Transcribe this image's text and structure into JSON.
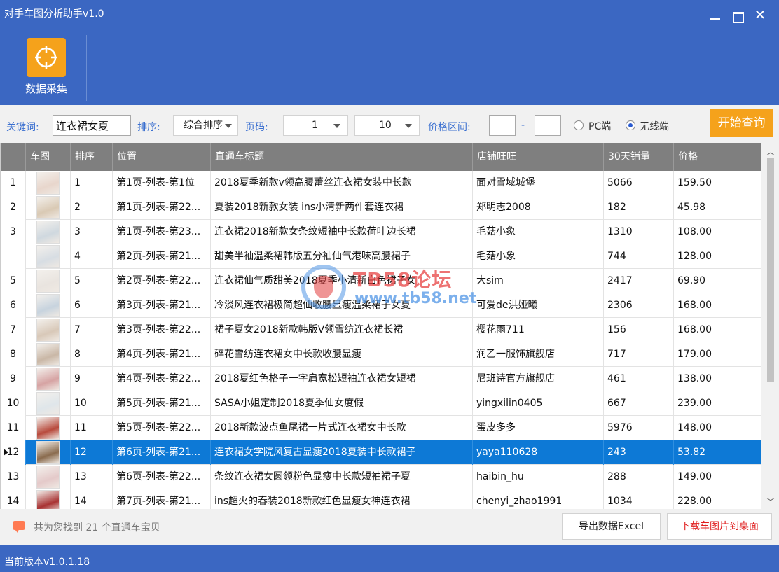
{
  "app": {
    "title": "对手车图分析助手v1.0",
    "window_buttons": {
      "minimize": "minimize-icon",
      "maximize": "maximize-icon",
      "close": "✕"
    }
  },
  "ribbon": {
    "collect_label": "数据采集",
    "collect_icon": "crosshair-icon"
  },
  "toolbar": {
    "keyword_label": "关键词:",
    "keyword_value": "连衣裙女夏",
    "sort_label": "排序:",
    "sort_value": "综合排序",
    "page_label": "页码:",
    "page_from": "1",
    "page_to": "10",
    "price_label": "价格区间:",
    "price_sep": "-",
    "radio_pc": "PC端",
    "radio_wireless": "无线端",
    "radio_selected": "无线端",
    "start_button": "开始查询",
    "colors": {
      "accent_orange": "#f5a21b",
      "label_blue": "#3a6fd0"
    }
  },
  "table": {
    "columns": [
      "车图",
      "排序",
      "位置",
      "直通车标题",
      "店铺旺旺",
      "30天销量",
      "价格"
    ],
    "selected_row": 12,
    "rows": [
      {
        "num": "1",
        "rank": "1",
        "pos": "第1页-列表-第1位",
        "title": "2018夏季新款v领高腰蕾丝连衣裙女装中长款",
        "shop": "面对雪域城堡",
        "sales": "5066",
        "price": "159.50",
        "thumb": "#e8d6cc"
      },
      {
        "num": "2",
        "rank": "2",
        "pos": "第1页-列表-第22...",
        "title": "夏装2018新款女装 ins小清新两件套连衣裙",
        "shop": "郑明志2008",
        "sales": "182",
        "price": "45.98",
        "thumb": "#d9c9b4"
      },
      {
        "num": "3",
        "rank": "3",
        "pos": "第1页-列表-第23...",
        "title": "连衣裙2018新款女条纹短袖中长款荷叶边长裙",
        "shop": "毛菇小象",
        "sales": "1310",
        "price": "108.00",
        "thumb": "#cfd8df"
      },
      {
        "num": "",
        "rank": "4",
        "pos": "第2页-列表-第21...",
        "title": "甜美半袖温柔裙韩版五分袖仙气港味高腰裙子",
        "shop": "毛菇小象",
        "sales": "744",
        "price": "128.00",
        "thumb": "#d7dde3"
      },
      {
        "num": "5",
        "rank": "5",
        "pos": "第2页-列表-第22...",
        "title": "连衣裙仙气质甜美2018夏季小清新白色裙子女",
        "shop": "大sim",
        "sales": "2417",
        "price": "69.90",
        "thumb": "#e9e4df"
      },
      {
        "num": "6",
        "rank": "6",
        "pos": "第3页-列表-第21...",
        "title": "冷淡风连衣裙极简超仙收腰显瘦温柔裙子女夏",
        "shop": "可爱de洪娅曦",
        "sales": "2306",
        "price": "168.00",
        "thumb": "#c7d3de"
      },
      {
        "num": "7",
        "rank": "7",
        "pos": "第3页-列表-第22...",
        "title": "裙子夏女2018新款韩版V领雪纺连衣裙长裙",
        "shop": "樱花雨711",
        "sales": "156",
        "price": "168.00",
        "thumb": "#d8c8b8"
      },
      {
        "num": "8",
        "rank": "8",
        "pos": "第4页-列表-第21...",
        "title": "碎花雪纺连衣裙女中长款收腰显瘦",
        "shop": "润乙一服饰旗舰店",
        "sales": "717",
        "price": "179.00",
        "thumb": "#c9b7a6"
      },
      {
        "num": "9",
        "rank": "9",
        "pos": "第4页-列表-第22...",
        "title": "2018夏红色格子一字肩宽松短袖连衣裙女短裙",
        "shop": "尼班诗官方旗舰店",
        "sales": "461",
        "price": "138.00",
        "thumb": "#d6a3a3"
      },
      {
        "num": "10",
        "rank": "10",
        "pos": "第5页-列表-第21...",
        "title": "SASA小姐定制2018夏季仙女度假",
        "shop": "yingxilin0405",
        "sales": "667",
        "price": "239.00",
        "thumb": "#dfe6ea"
      },
      {
        "num": "11",
        "rank": "11",
        "pos": "第5页-列表-第22...",
        "title": "2018新款波点鱼尾裙一片式连衣裙女中长款",
        "shop": "蛋皮多多",
        "sales": "5976",
        "price": "148.00",
        "thumb": "#b84a3c"
      },
      {
        "num": "12",
        "rank": "12",
        "pos": "第6页-列表-第21...",
        "title": "连衣裙女学院风复古显瘦2018夏装中长款裙子",
        "shop": "yaya110628",
        "sales": "243",
        "price": "53.82",
        "thumb": "#8a6b4e"
      },
      {
        "num": "13",
        "rank": "13",
        "pos": "第6页-列表-第22...",
        "title": "条纹连衣裙女圆领粉色显瘦中长款短袖裙子夏",
        "shop": "haibin_hu",
        "sales": "288",
        "price": "149.00",
        "thumb": "#e4c9c9"
      },
      {
        "num": "14",
        "rank": "14",
        "pos": "第7页-列表-第21...",
        "title": "ins超火的春装2018新款红色显瘦女神连衣裙",
        "shop": "chenyi_zhao1991",
        "sales": "1034",
        "price": "228.00",
        "thumb": "#a83232"
      }
    ]
  },
  "footer": {
    "found_text": "共为您找到 21 个直通车宝贝",
    "export_button": "导出数据Excel",
    "download_button": "下载车图片到桌面"
  },
  "status": {
    "version": "当前版本v1.0.1.18"
  },
  "watermark": {
    "line1": "TB58论坛",
    "line2": "www.tb58.net"
  }
}
